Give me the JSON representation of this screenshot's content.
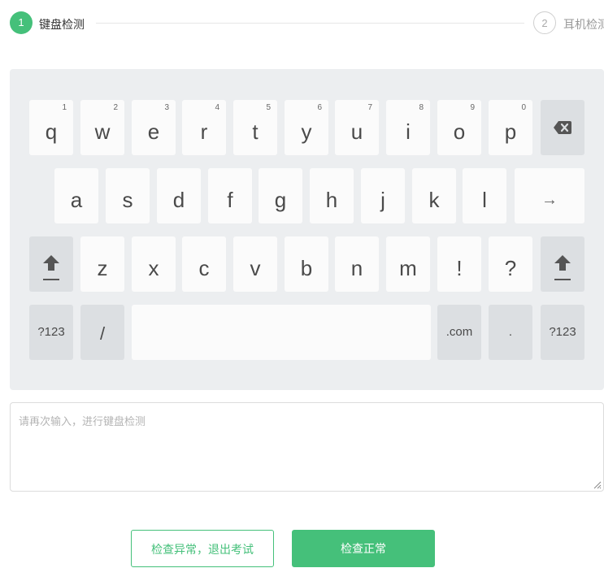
{
  "steps": [
    {
      "number": "1",
      "label": "键盘检测",
      "state": "active"
    },
    {
      "number": "2",
      "label": "耳机检测",
      "state": "inactive"
    }
  ],
  "keyboard": {
    "row1": [
      {
        "char": "q",
        "hint": "1"
      },
      {
        "char": "w",
        "hint": "2"
      },
      {
        "char": "e",
        "hint": "3"
      },
      {
        "char": "r",
        "hint": "4"
      },
      {
        "char": "t",
        "hint": "5"
      },
      {
        "char": "y",
        "hint": "6"
      },
      {
        "char": "u",
        "hint": "7"
      },
      {
        "char": "i",
        "hint": "8"
      },
      {
        "char": "o",
        "hint": "9"
      },
      {
        "char": "p",
        "hint": "0"
      }
    ],
    "row2": [
      "a",
      "s",
      "d",
      "f",
      "g",
      "h",
      "j",
      "k",
      "l"
    ],
    "row3": [
      "z",
      "x",
      "c",
      "v",
      "b",
      "n",
      "m",
      "!",
      "?"
    ],
    "enter_symbol": "→",
    "symbols_left": "?123",
    "slash": "/",
    "dotcom": ".com",
    "period": ".",
    "symbols_right": "?123",
    "icons": {
      "backspace": "backspace-icon",
      "shift": "shift-icon"
    }
  },
  "input": {
    "placeholder": "请再次输入，进行键盘检测",
    "value": ""
  },
  "actions": {
    "abnormal_label": "检查异常，退出考试",
    "normal_label": "检查正常"
  },
  "colors": {
    "accent": "#45c07a",
    "keyboard_bg": "#eceef0",
    "key_bg": "#fbfbfb",
    "key_dark_bg": "#dcdfe2"
  }
}
